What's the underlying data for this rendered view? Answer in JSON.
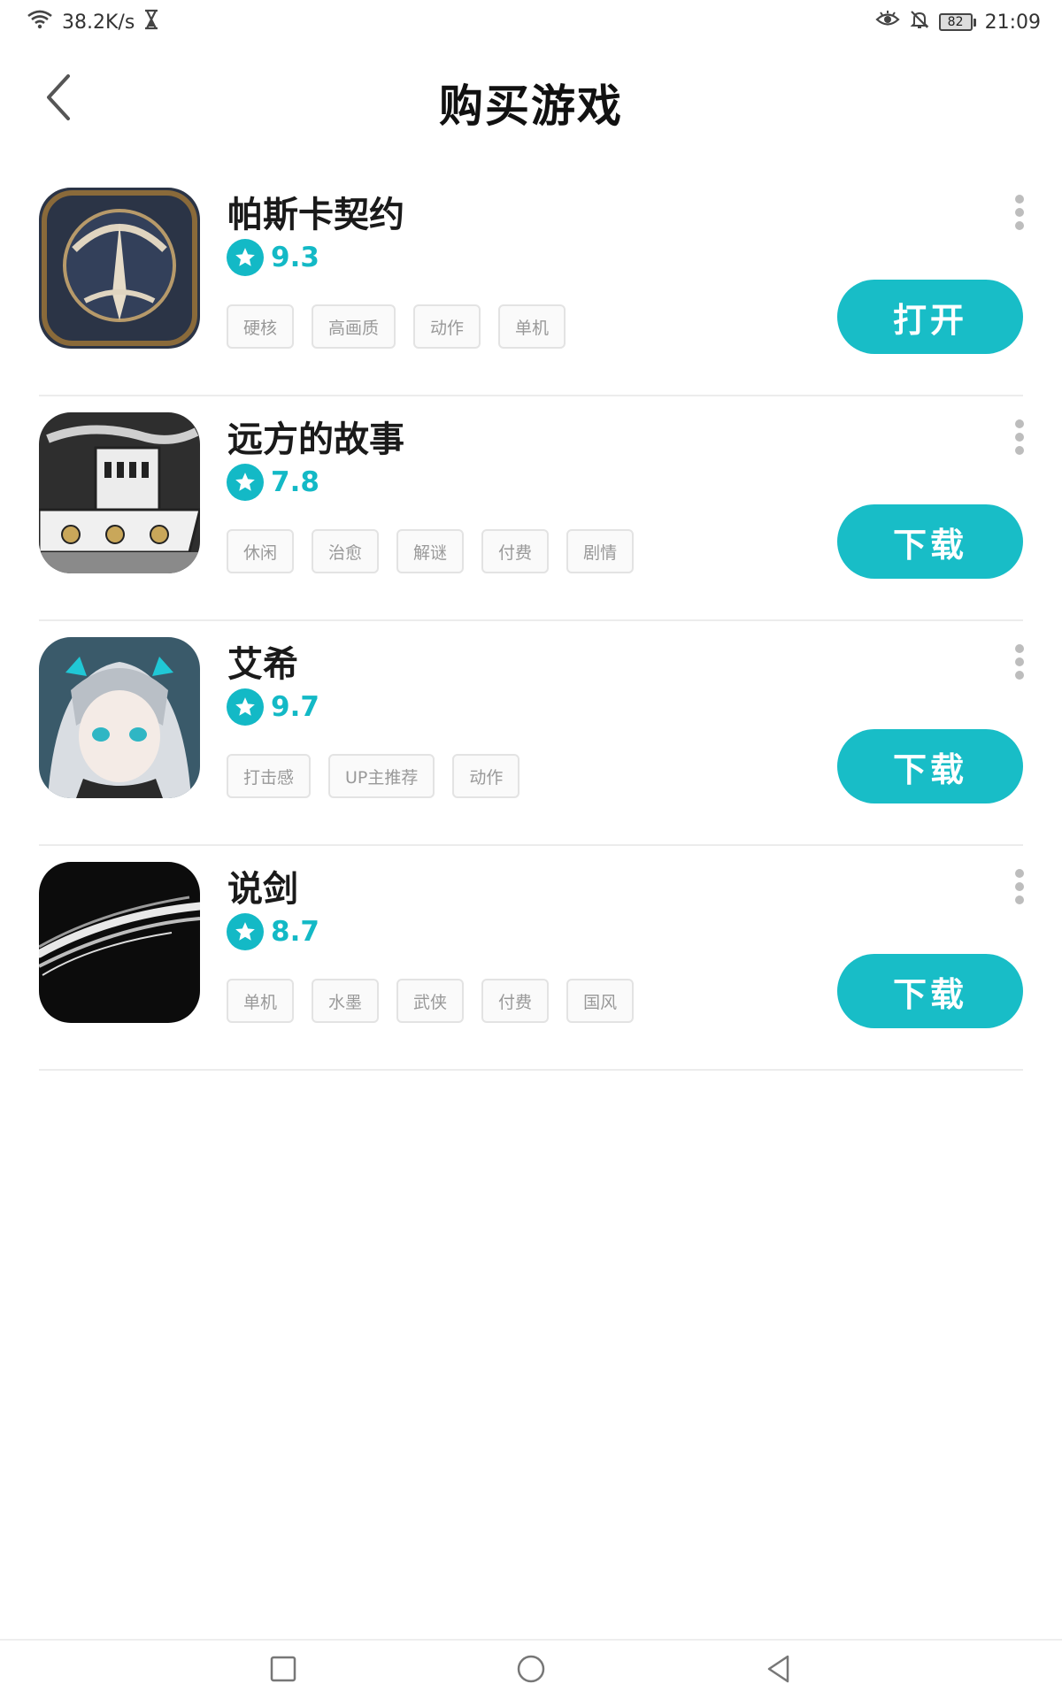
{
  "status_bar": {
    "network_speed": "38.2K/s",
    "battery_level": "82",
    "time": "21:09"
  },
  "header": {
    "title": "购买游戏"
  },
  "colors": {
    "accent": "#18bdc7",
    "rating": "#13b9c6"
  },
  "games": [
    {
      "name": "帕斯卡契约",
      "rating": "9.3",
      "tags": [
        "硬核",
        "高画质",
        "动作",
        "单机"
      ],
      "action": "打开"
    },
    {
      "name": "远方的故事",
      "rating": "7.8",
      "tags": [
        "休闲",
        "治愈",
        "解谜",
        "付费",
        "剧情"
      ],
      "action": "下载"
    },
    {
      "name": "艾希",
      "rating": "9.7",
      "tags": [
        "打击感",
        "UP主推荐",
        "动作"
      ],
      "action": "下载"
    },
    {
      "name": "说剑",
      "rating": "8.7",
      "tags": [
        "单机",
        "水墨",
        "武侠",
        "付费",
        "国风"
      ],
      "action": "下载"
    }
  ]
}
